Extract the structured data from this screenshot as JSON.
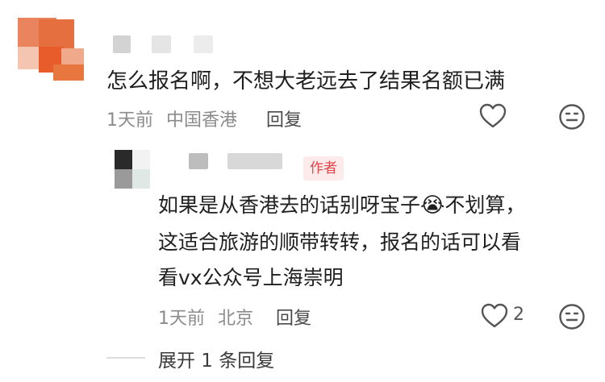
{
  "comment_1": {
    "text": "怎么报名啊，不想大老远去了结果名额已满",
    "time": "1天前",
    "location": "中国香港",
    "reply_label": "回复"
  },
  "comment_2": {
    "author_tag": "作者",
    "text_line_1": "如果是从香港去的话别呀宝子",
    "emoji": "😭",
    "text_line_1b": "不划算，",
    "text_line_2": "这适合旅游的顺带转转，报名的话可以看",
    "text_line_3": "看vx公众号上海崇明",
    "time": "1天前",
    "location": "北京",
    "reply_label": "回复",
    "like_count": "2"
  },
  "expand_replies": "展开 1 条回复",
  "icons": [
    "heart-icon",
    "neutral-face-icon",
    "heart-icon",
    "neutral-face-icon"
  ]
}
